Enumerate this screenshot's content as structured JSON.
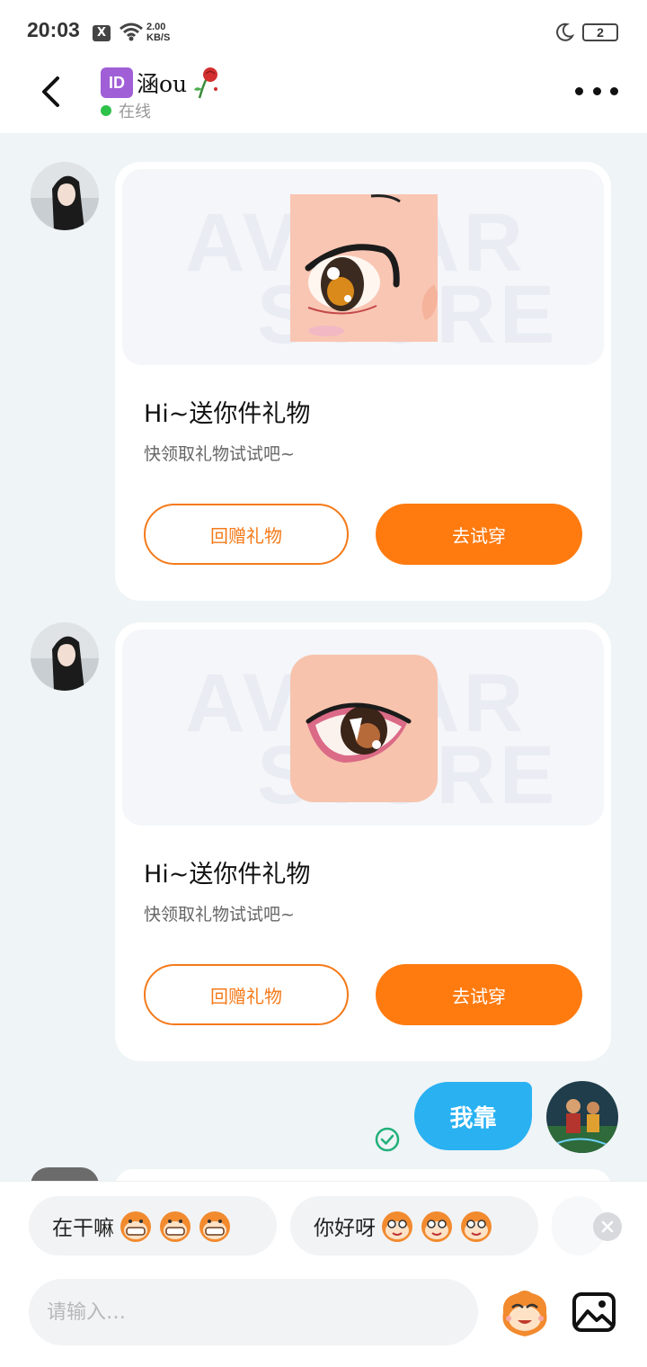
{
  "status_bar": {
    "time": "20:03",
    "x_icon": "X",
    "speed_value": "2.00",
    "speed_unit": "KB/S",
    "battery": "2"
  },
  "header": {
    "id_badge": "ID",
    "contact_name": "涵ou",
    "status": "在线",
    "icons": [
      "back-arrow-icon",
      "rose-icon",
      "more-icon"
    ]
  },
  "messages": [
    {
      "type": "gift",
      "from": "contact",
      "watermark_top": "AVATAR",
      "watermark_bottom": "STORE",
      "title": "Hi~送你件礼物",
      "subtitle": "快领取礼物试试吧~",
      "return_gift_label": "回赠礼物",
      "try_on_label": "去试穿"
    },
    {
      "type": "gift",
      "from": "contact",
      "watermark_top": "AVATAR",
      "watermark_bottom": "STORE",
      "title": "Hi~送你件礼物",
      "subtitle": "快领取礼物试试吧~",
      "return_gift_label": "回赠礼物",
      "try_on_label": "去试穿"
    },
    {
      "type": "text",
      "from": "me",
      "text": "我靠",
      "read": true
    }
  ],
  "quick_replies": [
    {
      "text": "在干嘛",
      "emoji": "grinning-monkey-icon"
    },
    {
      "text": "你好呀",
      "emoji": "smiling-monkey-icon"
    }
  ],
  "input": {
    "placeholder": "请输入…"
  },
  "colors": {
    "accent_orange": "#ff7b10",
    "bubble_blue": "#29b1f2",
    "online_green": "#2fc24a",
    "id_purple": "#a05fd6"
  }
}
